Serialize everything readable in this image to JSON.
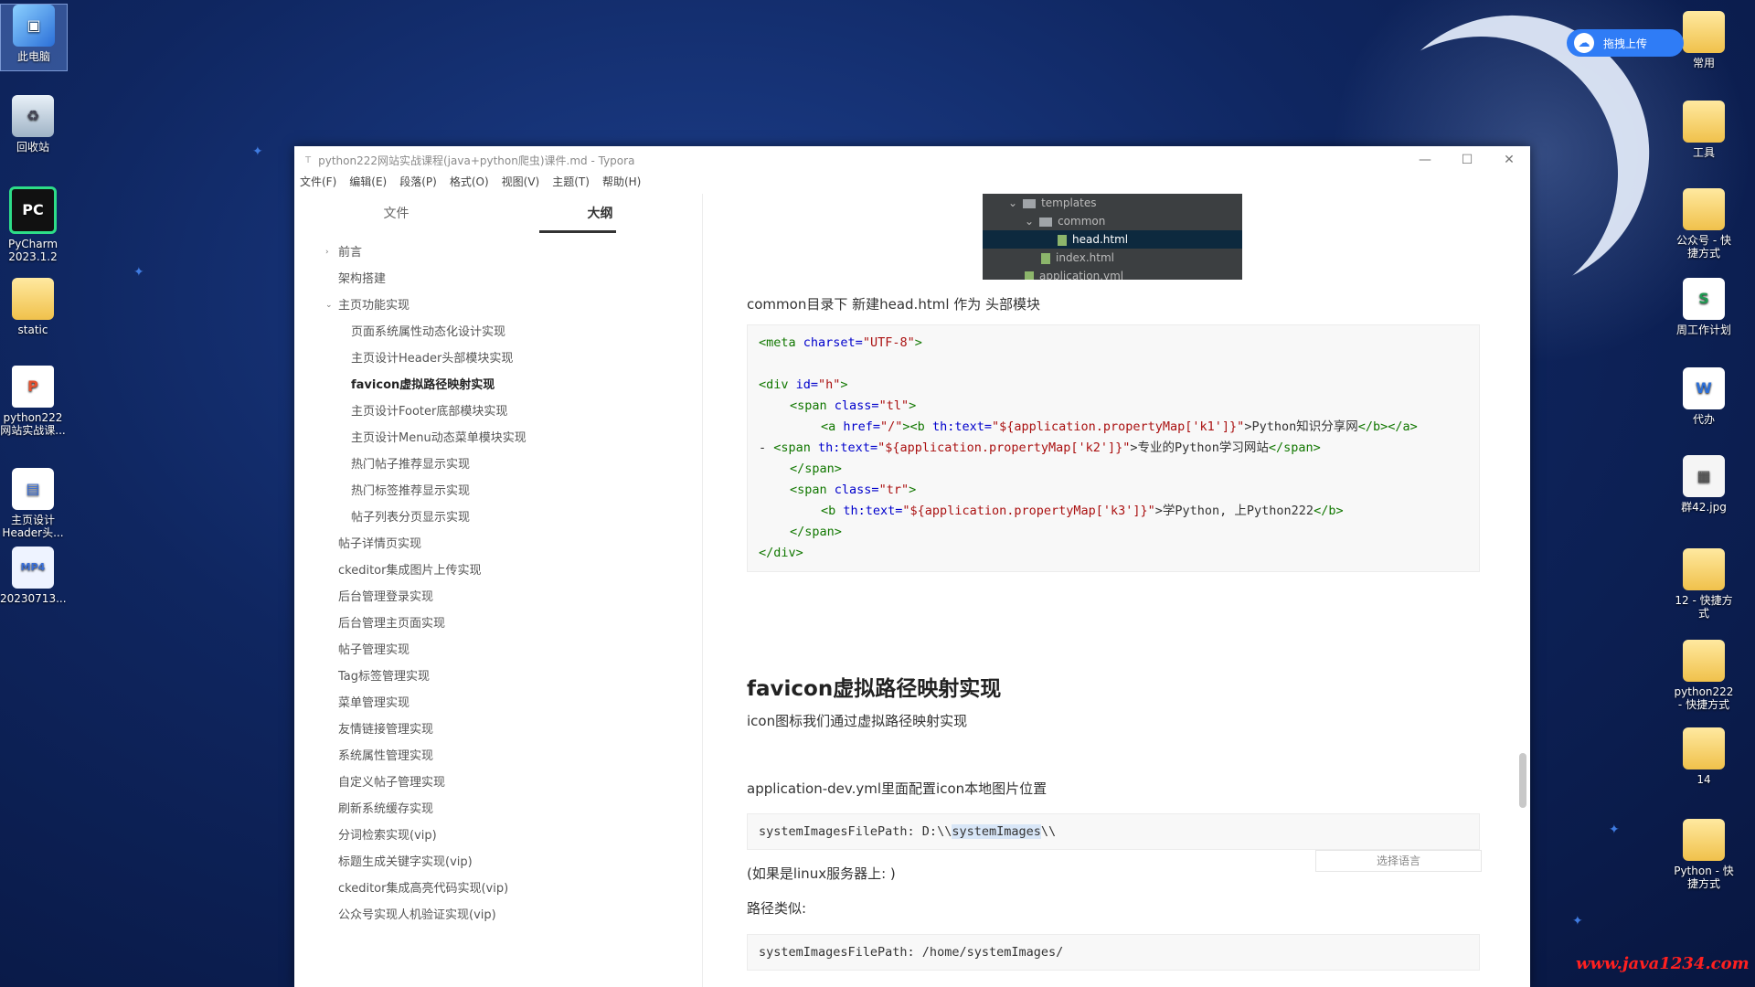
{
  "desktop": {
    "left_icons": [
      {
        "label": "此电脑",
        "icon": "computer-icon"
      },
      {
        "label": "回收站",
        "icon": "recycle-bin-icon"
      },
      {
        "label": "PyCharm 2023.1.2",
        "icon": "pycharm-icon"
      },
      {
        "label": "static",
        "icon": "folder-icon"
      },
      {
        "label": "python222 网站实战课...",
        "icon": "ppt-file-icon"
      },
      {
        "label": "主页设计 Header头...",
        "icon": "screenshot-file-icon"
      },
      {
        "label": "20230713...",
        "icon": "mp4-file-icon"
      }
    ],
    "right_icons": [
      {
        "label": "常用",
        "icon": "folder-shortcut-icon"
      },
      {
        "label": "工具",
        "icon": "folder-shortcut-icon"
      },
      {
        "label": "公众号 - 快 捷方式",
        "icon": "folder-shortcut-icon"
      },
      {
        "label": "周工作计划",
        "icon": "spreadsheet-icon"
      },
      {
        "label": "代办",
        "icon": "word-doc-icon"
      },
      {
        "label": "群42.jpg",
        "icon": "image-file-icon"
      },
      {
        "label": "12 - 快捷方 式",
        "icon": "folder-shortcut-icon"
      },
      {
        "label": "python222 - 快捷方式",
        "icon": "folder-shortcut-icon"
      },
      {
        "label": "14",
        "icon": "folder-icon"
      },
      {
        "label": "Python - 快 捷方式",
        "icon": "folder-shortcut-icon"
      }
    ],
    "upload_button": "拖拽上传",
    "watermark": "www.java1234.com"
  },
  "window": {
    "title": "python222网站实战课程(java+python爬虫)课件.md - Typora",
    "menu": [
      "文件(F)",
      "编辑(E)",
      "段落(P)",
      "格式(O)",
      "视图(V)",
      "主题(T)",
      "帮助(H)"
    ]
  },
  "sidebar": {
    "tabs": [
      "文件",
      "大纲"
    ],
    "outline": [
      {
        "label": "前言",
        "level": 1,
        "arrow": "›"
      },
      {
        "label": "架构搭建",
        "level": 1
      },
      {
        "label": "主页功能实现",
        "level": 1,
        "arrow": "⌄"
      },
      {
        "label": "页面系统属性动态化设计实现",
        "level": 2
      },
      {
        "label": "主页设计Header头部模块实现",
        "level": 2
      },
      {
        "label": "favicon虚拟路径映射实现",
        "level": 2,
        "active": true
      },
      {
        "label": "主页设计Footer底部模块实现",
        "level": 2
      },
      {
        "label": "主页设计Menu动态菜单模块实现",
        "level": 2
      },
      {
        "label": "热门帖子推荐显示实现",
        "level": 2
      },
      {
        "label": "热门标签推荐显示实现",
        "level": 2
      },
      {
        "label": "帖子列表分页显示实现",
        "level": 2
      },
      {
        "label": "帖子详情页实现",
        "level": 1
      },
      {
        "label": "ckeditor集成图片上传实现",
        "level": 1
      },
      {
        "label": "后台管理登录实现",
        "level": 1
      },
      {
        "label": "后台管理主页面实现",
        "level": 1
      },
      {
        "label": "帖子管理实现",
        "level": 1
      },
      {
        "label": "Tag标签管理实现",
        "level": 1
      },
      {
        "label": "菜单管理实现",
        "level": 1
      },
      {
        "label": "友情链接管理实现",
        "level": 1
      },
      {
        "label": "系统属性管理实现",
        "level": 1
      },
      {
        "label": "自定义帖子管理实现",
        "level": 1
      },
      {
        "label": "刷新系统缓存实现",
        "level": 1
      },
      {
        "label": "分词检索实现(vip)",
        "level": 1
      },
      {
        "label": "标题生成关键字实现(vip)",
        "level": 1
      },
      {
        "label": "ckeditor集成高亮代码实现(vip)",
        "level": 1
      },
      {
        "label": "公众号实现人机验证实现(vip)",
        "level": 1
      }
    ]
  },
  "content": {
    "file_tree": [
      {
        "label": "templates",
        "type": "folder",
        "arrow": "⌄"
      },
      {
        "label": "common",
        "type": "folder",
        "arrow": "⌄"
      },
      {
        "label": "head.html",
        "type": "file",
        "selected": true
      },
      {
        "label": "index.html",
        "type": "file"
      },
      {
        "label": "application.yml",
        "type": "file"
      }
    ],
    "p1": "common目录下 新建head.html 作为 头部模块",
    "code1": {
      "l1_tag": "<meta ",
      "l1_attr": "charset=",
      "l1_str": "\"UTF-8\"",
      "l1_end": ">",
      "l3_tag": "<div ",
      "l3_attr": "id=",
      "l3_str": "\"h\"",
      "l3_end": ">",
      "l4_tag": "<span ",
      "l4_attr": "class=",
      "l4_str": "\"tl\"",
      "l4_end": ">",
      "l5_a": "<a ",
      "l5_href": "href=",
      "l5_href_v": "\"/\"",
      "l5_b": "><b ",
      "l5_th": "th:text=",
      "l5_str": "\"${application.propertyMap['k1']}\"",
      "l5_txt": ">Python知识分享网",
      "l5_end": "</b></a>",
      "l6_dash": "- ",
      "l6_tag": "<span ",
      "l6_attr": "th:text=",
      "l6_str": "\"${application.propertyMap['k2']}\"",
      "l6_txt": ">专业的Python学习网站",
      "l6_end": "</span>",
      "l7": "</span>",
      "l8_tag": "<span ",
      "l8_attr": "class=",
      "l8_str": "\"tr\"",
      "l8_end": ">",
      "l9_tag": "<b ",
      "l9_attr": "th:text=",
      "l9_str": "\"${application.propertyMap['k3']}\"",
      "l9_txt": ">学Python, 上Python222",
      "l9_end": "</b>",
      "l10": "</span>",
      "l11": "</div>"
    },
    "heading": "favicon虚拟路径映射实现",
    "p2": "icon图标我们通过虚拟路径映射实现",
    "p3": "application-dev.yml里面配置icon本地图片位置",
    "code2_pre": "systemImagesFilePath: D:\\\\",
    "code2_sel": "systemImages",
    "code2_post": "\\\\",
    "lang_select": "选择语言",
    "p4": "(如果是linux服务器上: )",
    "p5": "路径类似:",
    "code3": "systemImagesFilePath: /home/systemImages/"
  },
  "colors": {
    "accent": "#2f7cf6",
    "code_tag": "#117700",
    "code_attr": "#0000cc",
    "code_str": "#aa1111"
  }
}
